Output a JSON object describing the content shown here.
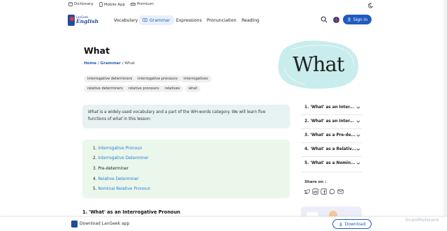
{
  "topbar": {
    "dictionary": "Dictionary",
    "mobile_app": "Mobile App",
    "premium": "Premium"
  },
  "logo": {
    "small_text": "LanGeek",
    "big_text": "English"
  },
  "nav": {
    "items": [
      "Vocabulary",
      "Grammar",
      "Expressions",
      "Pronunciation",
      "Reading"
    ],
    "active": "Grammar",
    "signin": "Sign in"
  },
  "page": {
    "title": "What",
    "breadcrumb": {
      "home": "Home",
      "sep1": " / ",
      "grammar": "Grammar",
      "sep2": " / ",
      "current": "What"
    },
    "tags": [
      "interrogative determiners",
      "interrogative pronouns",
      "interrogatives",
      "relative determiners",
      "relative pronouns",
      "relatives",
      "what"
    ],
    "hero_word": "What",
    "intro": {
      "word1": "What",
      "text1": " is a widely-used vocabulary and a part of the WH-words category. We will learn five functions of ",
      "word2": "what",
      "text2": " in this lesson:"
    },
    "lessons": [
      {
        "num": "1.",
        "label": "Interrogative Pronoun",
        "link": true
      },
      {
        "num": "2.",
        "label": "Interrogative Determiner",
        "link": true
      },
      {
        "num": "3.",
        "label": "Pre-determiner",
        "link": false
      },
      {
        "num": "4.",
        "label": "Relative Determiner",
        "link": true
      },
      {
        "num": "5.",
        "label": "Nominal Relative Pronoun",
        "link": true
      }
    ],
    "section_title": "1. 'What' as an Interrogative Pronoun"
  },
  "sidebar": {
    "toc": [
      "1. 'What' as an Inter...",
      "2. 'What' as an Inter...",
      "3. 'What' as a Pre-de...",
      "4. 'What' as a Relativ...",
      "5. 'What' as a Nomin..."
    ],
    "share_label": "Share on :",
    "share_icons": [
      "twitter-icon",
      "linkedin-icon",
      "facebook-icon",
      "whatsapp-icon",
      "email-icon"
    ]
  },
  "bottombar": {
    "label": "Download LanGeek app",
    "button": "Download"
  },
  "watermark": "ScanMalware",
  "colors": {
    "brand_blue": "#1f5cc0",
    "intro_bg": "#e7f2f2",
    "lesson_bg": "#eaf7ea",
    "hero_blob": "#c9ecec",
    "link": "#2a7bd8"
  }
}
